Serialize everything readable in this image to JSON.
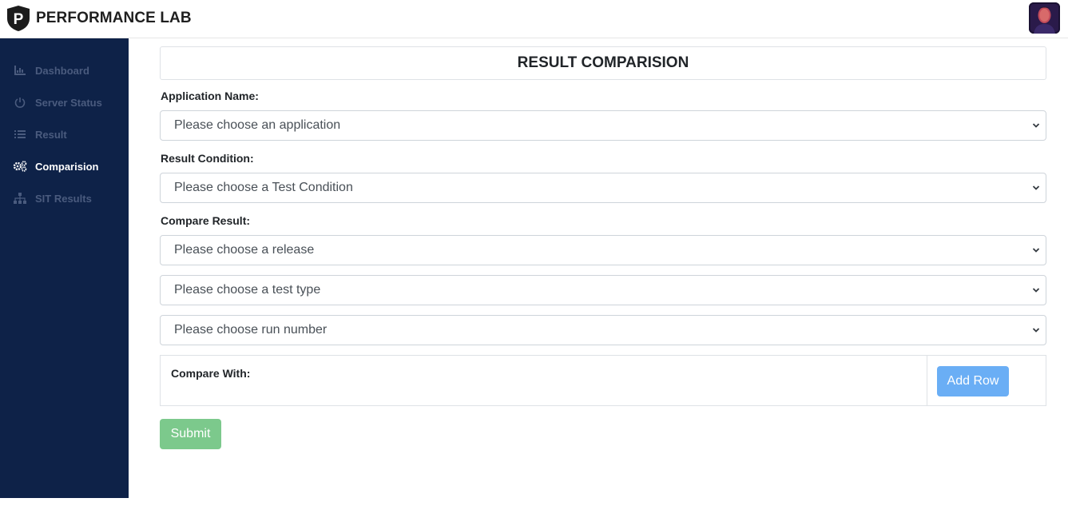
{
  "header": {
    "logo_letter": "P",
    "brand": "PERFORMANCE LAB"
  },
  "sidebar": {
    "items": [
      {
        "label": "Dashboard",
        "icon": "chart-icon",
        "active": false
      },
      {
        "label": "Server Status",
        "icon": "power-icon",
        "active": false
      },
      {
        "label": "Result",
        "icon": "list-icon",
        "active": false
      },
      {
        "label": "Comparision",
        "icon": "cogs-icon",
        "active": true
      },
      {
        "label": "SIT Results",
        "icon": "sitemap-icon",
        "active": false
      }
    ]
  },
  "main": {
    "title": "RESULT COMPARISION",
    "application_label": "Application Name:",
    "application_select": "Please choose an application",
    "condition_label": "Result Condition:",
    "condition_select": "Please choose a Test Condition",
    "compare_label": "Compare Result:",
    "release_select": "Please choose a release",
    "test_type_select": "Please choose a test type",
    "run_number_select": "Please choose run number",
    "compare_with_label": "Compare With:",
    "add_row_button": "Add Row",
    "submit_button": "Submit"
  },
  "colors": {
    "sidebar_bg": "#0e2248",
    "add_row": "#6aaef5",
    "submit": "#7cc98c"
  }
}
